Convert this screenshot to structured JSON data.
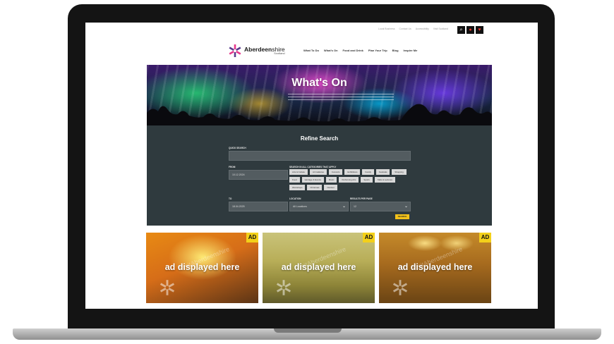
{
  "util_links": [
    "Local Business",
    "Contact Us",
    "Accessibility",
    "Visit Scotland"
  ],
  "util_icons": [
    "search-icon",
    "pin-icon",
    "heart-icon"
  ],
  "logo": {
    "name_bold": "Aberdeen",
    "name_light": "shire",
    "sub": "Scotland"
  },
  "nav": [
    "What To Do",
    "What's On",
    "Food and Drink",
    "Plan Your Trip",
    "Blog",
    "Inspire Me"
  ],
  "hero": {
    "title": "What's On"
  },
  "refine": {
    "title": "Refine Search",
    "quick_search_label": "QUICK SEARCH",
    "quick_search_value": "",
    "from_label": "FROM",
    "from_value": "10.12.2024",
    "to_label": "TO",
    "to_value": "18.04.2025",
    "categories_label": "SEARCH IN ALL CATEGORIES THAT APPLY",
    "categories": [
      "Arts & Culture",
      "Art Galleries",
      "Concerts",
      "Exhibitions",
      "Family",
      "Festivals",
      "Shopping",
      "Food",
      "Heritage & Events",
      "Music",
      "Performing Arts",
      "Sports",
      "Talks & Lectures",
      "Workshops",
      "Christmas",
      "Outdoor"
    ],
    "location_label": "LOCATION",
    "location_value": "All Locations",
    "results_label": "RESULTS PER PAGE",
    "results_value": "12",
    "search_button": "SEARCH"
  },
  "ads": [
    {
      "badge": "AD",
      "text": "ad displayed here",
      "watermark": "VisitAberdeenshire"
    },
    {
      "badge": "AD",
      "text": "ad displayed here",
      "watermark": "VisitAberdeenshire"
    },
    {
      "badge": "AD",
      "text": "ad displayed here",
      "watermark": "VisitAberdeenshire"
    }
  ],
  "colors": {
    "panel": "#2f3a3e",
    "field": "#535c60",
    "chip": "#d9d9d9",
    "accent_yellow": "#f3c21a",
    "ad_badge": "#f3d01a",
    "logo_pink": "#e6388c",
    "logo_purple": "#5a3a8c"
  }
}
